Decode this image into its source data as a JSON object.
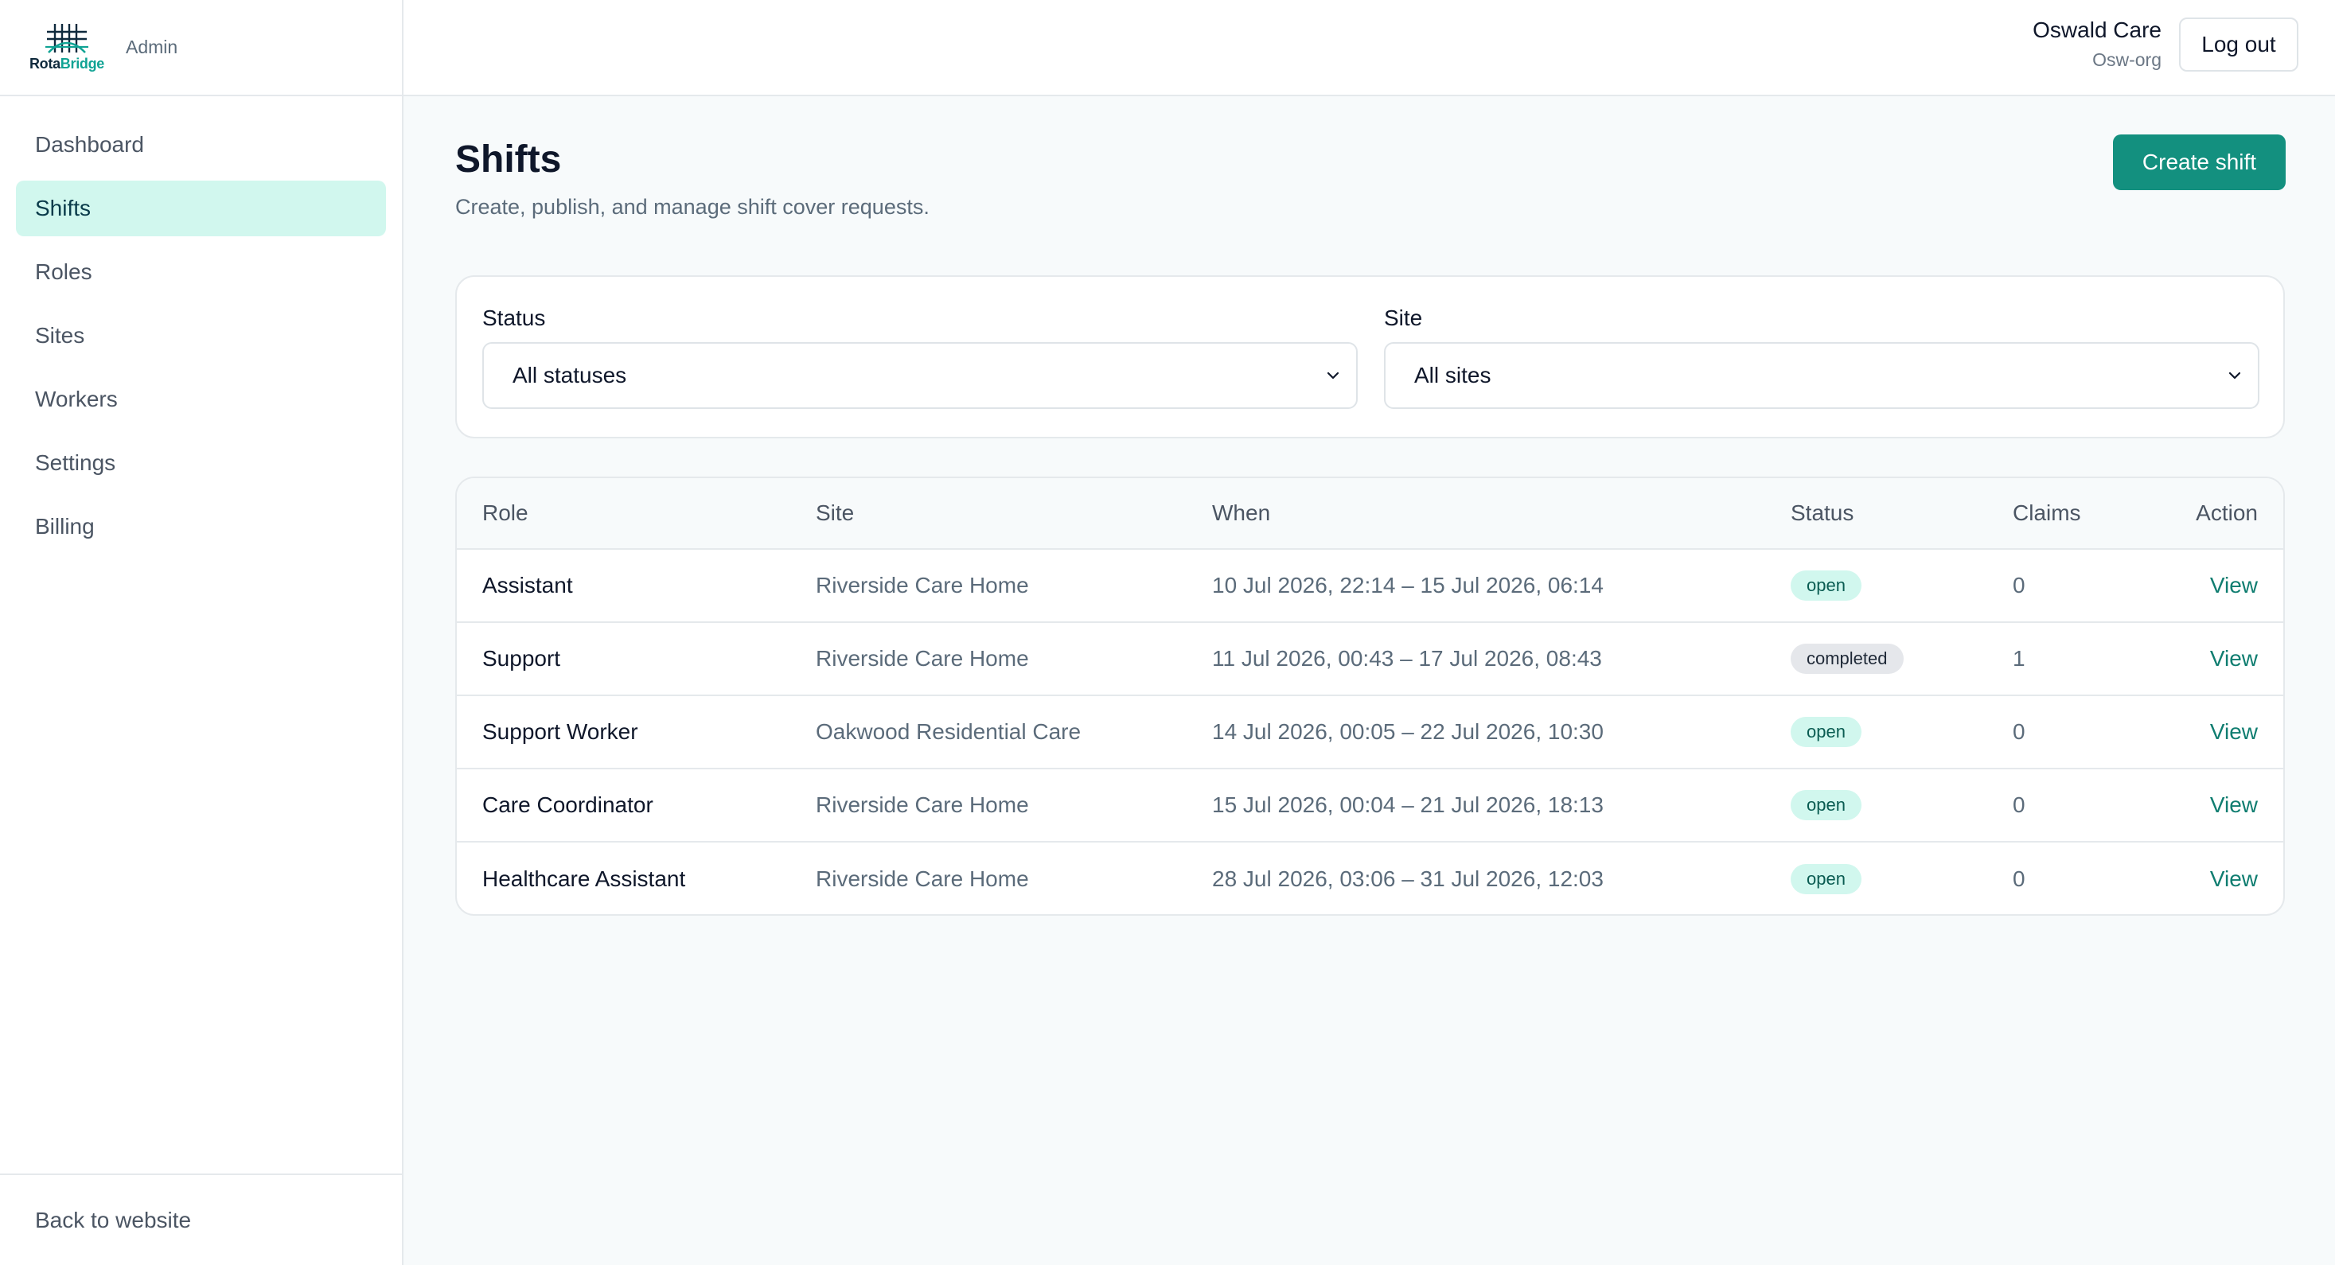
{
  "brand": {
    "logo_text_a": "Rota",
    "logo_text_b": "Bridge",
    "role": "Admin",
    "accent": "#10a394"
  },
  "sidebar": {
    "items": [
      {
        "label": "Dashboard",
        "active": false
      },
      {
        "label": "Shifts",
        "active": true
      },
      {
        "label": "Roles",
        "active": false
      },
      {
        "label": "Sites",
        "active": false
      },
      {
        "label": "Workers",
        "active": false
      },
      {
        "label": "Settings",
        "active": false
      },
      {
        "label": "Billing",
        "active": false
      }
    ],
    "footer_link": "Back to website"
  },
  "header": {
    "org_name": "Oswald Care",
    "org_slug": "Osw-org",
    "logout_label": "Log out"
  },
  "page": {
    "title": "Shifts",
    "subtitle": "Create, publish, and manage shift cover requests.",
    "create_label": "Create shift"
  },
  "filters": {
    "status": {
      "label": "Status",
      "value": "All statuses"
    },
    "site": {
      "label": "Site",
      "value": "All sites"
    }
  },
  "table": {
    "columns": [
      "Role",
      "Site",
      "When",
      "Status",
      "Claims",
      "Action"
    ],
    "rows": [
      {
        "role": "Assistant",
        "site": "Riverside Care Home",
        "when": "10 Jul 2026, 22:14 – 15 Jul 2026, 06:14",
        "status": "open",
        "claims": "0",
        "action": "View"
      },
      {
        "role": "Support",
        "site": "Riverside Care Home",
        "when": "11 Jul 2026, 00:43 – 17 Jul 2026, 08:43",
        "status": "completed",
        "claims": "1",
        "action": "View"
      },
      {
        "role": "Support Worker",
        "site": "Oakwood Residential Care",
        "when": "14 Jul 2026, 00:05 – 22 Jul 2026, 10:30",
        "status": "open",
        "claims": "0",
        "action": "View"
      },
      {
        "role": "Care Coordinator",
        "site": "Riverside Care Home",
        "when": "15 Jul 2026, 00:04 – 21 Jul 2026, 18:13",
        "status": "open",
        "claims": "0",
        "action": "View"
      },
      {
        "role": "Healthcare Assistant",
        "site": "Riverside Care Home",
        "when": "28 Jul 2026, 03:06 – 31 Jul 2026, 12:03",
        "status": "open",
        "claims": "0",
        "action": "View"
      }
    ]
  },
  "colors": {
    "primary": "#13907f",
    "active_nav_bg": "#d1f7ee",
    "open_badge": "#d1f7ee",
    "completed_badge": "#e5e7eb"
  }
}
